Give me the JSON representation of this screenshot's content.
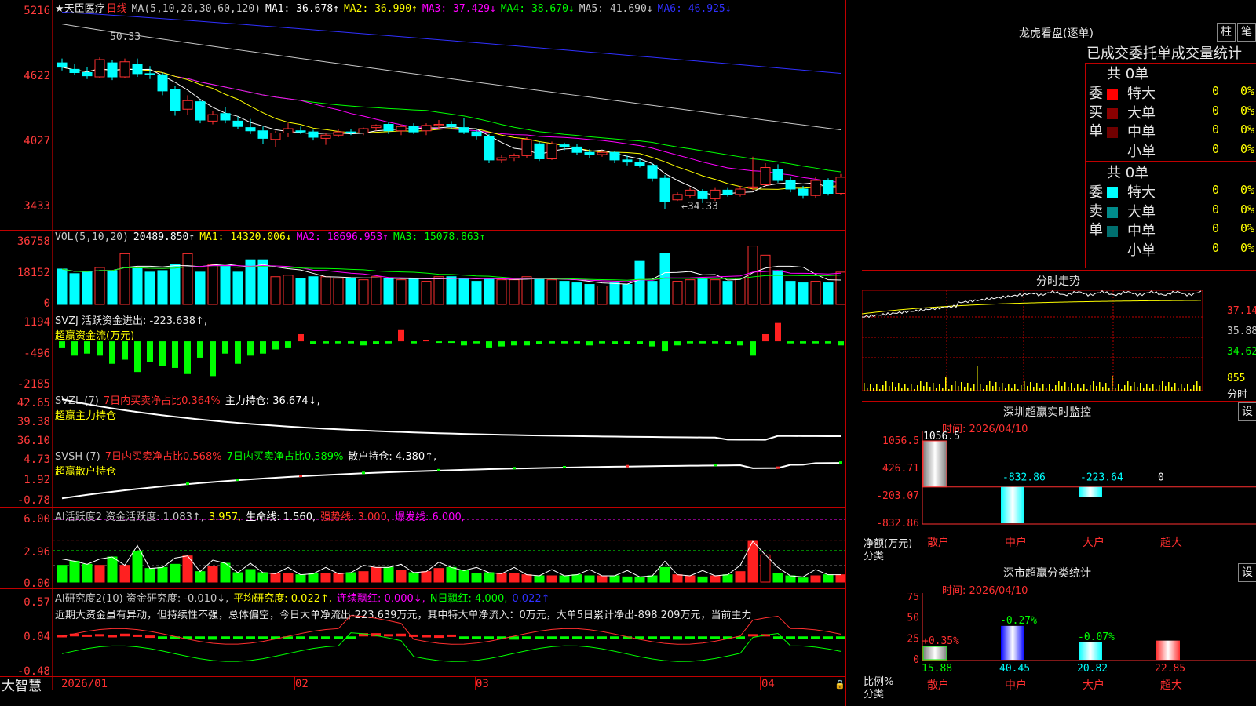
{
  "stock": {
    "name": "★天臣医疗",
    "period": "日线"
  },
  "main": {
    "price_axis": [
      "5216",
      "4622",
      "4027",
      "3433"
    ],
    "ma_title": "MA(5,10,20,30,60,120)",
    "ma": [
      {
        "label": "MA1: 36.678↑",
        "color": "#ffffff"
      },
      {
        "label": "MA2: 36.990↑",
        "color": "#ffff00"
      },
      {
        "label": "MA3: 37.429↓",
        "color": "#ff00ff"
      },
      {
        "label": "MA4: 38.670↓",
        "color": "#00ff00"
      },
      {
        "label": "MA5: 41.690↓",
        "color": "#c8c8c8"
      },
      {
        "label": "MA6: 46.925↓",
        "color": "#3030ff"
      }
    ],
    "high_label": "50.33",
    "low_label": "←34.33",
    "colors": {
      "up": "#ff3030",
      "down": "#00ffff",
      "ma1": "#ffffff",
      "ma2": "#ffff00",
      "ma3": "#ff00ff",
      "ma4": "#00ff00",
      "ma5": "#c8c8c8",
      "ma6": "#3030ff"
    }
  },
  "vol": {
    "axis": [
      "36758",
      "18152",
      "0"
    ],
    "title": "VOL(5,10,20)",
    "items": [
      {
        "label": "20489.850↑",
        "color": "#ffffff"
      },
      {
        "label": "MA1: 14320.006↓",
        "color": "#ffff00"
      },
      {
        "label": "MA2: 18696.953↑",
        "color": "#ff00ff"
      },
      {
        "label": "MA3: 15078.863↑",
        "color": "#00ff00"
      }
    ]
  },
  "svzj": {
    "axis": [
      "1194",
      "-496",
      "-2185"
    ],
    "title": "SVZJ  活跃资金进出: -223.638↑,",
    "subtitle": "超赢资金流(万元)"
  },
  "svzl": {
    "axis": [
      "42.65",
      "39.38",
      "36.10"
    ],
    "items": [
      {
        "label": "SVZL (7)",
        "color": "#c8c8c8"
      },
      {
        "label": "7日内买卖净占比0.364%",
        "color": "#ff3030"
      },
      {
        "label": "主力持仓: 36.674↓,",
        "color": "#ffffff"
      }
    ],
    "subtitle": "超赢主力持仓"
  },
  "svsh": {
    "axis": [
      "4.73",
      "1.92",
      "-0.78"
    ],
    "items": [
      {
        "label": "SVSH (7)",
        "color": "#c8c8c8"
      },
      {
        "label": "7日内买卖净占比0.568%",
        "color": "#ff3030"
      },
      {
        "label": "7日内买卖净占比0.389%",
        "color": "#00ff00"
      },
      {
        "label": "散户持仓: 4.380↑,",
        "color": "#ffffff"
      }
    ],
    "subtitle": "超赢散户持仓"
  },
  "ai_active": {
    "axis": [
      "6.00",
      "2.96",
      "0.00"
    ],
    "items": [
      {
        "label": "AI活跃度2 资金活跃度: 1.083↑,",
        "color": "#c8c8c8"
      },
      {
        "label": "3.957,",
        "color": "#ffff00"
      },
      {
        "label": "生命线: 1.560,",
        "color": "#ffffff"
      },
      {
        "label": "强势线: 3.000,",
        "color": "#ff3030"
      },
      {
        "label": "爆发线: 6.000,",
        "color": "#ff00ff"
      }
    ]
  },
  "ai_research": {
    "axis": [
      "0.57",
      "0.04",
      "-0.48"
    ],
    "items": [
      {
        "label": "AI研究度2(10) 资金研究度: -0.010↓,",
        "color": "#c8c8c8"
      },
      {
        "label": "平均研究度: 0.022↑,",
        "color": "#ffff00"
      },
      {
        "label": "连续飘红: 0.000↓,",
        "color": "#ff00ff"
      },
      {
        "label": "N日飘红: 4.000,",
        "color": "#00ff00"
      },
      {
        "label": "0.022↑",
        "color": "#3030ff"
      }
    ],
    "comment": "近期大资金虽有异动，但持续性不强，总体偏空，今日大单净流出-223.639万元，其中特大单净流入：0万元，大单5日累计净出-898.209万元，当前主力"
  },
  "date_axis": [
    "2026/01",
    "02",
    "03",
    "04"
  ],
  "brand": "大智慧",
  "right": {
    "lhb_title": "龙虎看盘(逐单)",
    "btn_zhu": "柱",
    "btn_bi": "笔",
    "tabs": [
      "已成交",
      "委托单",
      "成交量统计"
    ],
    "buy": {
      "side_label": "委买单",
      "total": "共 0单",
      "rows": [
        {
          "name": "特大",
          "color": "#ff0000",
          "value": "0",
          "pct": "0%"
        },
        {
          "name": "大单",
          "color": "#8b0000",
          "value": "0",
          "pct": "0%"
        },
        {
          "name": "中单",
          "color": "#700000",
          "value": "0",
          "pct": "0%"
        },
        {
          "name": "小单",
          "color": "#000000",
          "value": "0",
          "pct": "0%"
        }
      ]
    },
    "sell": {
      "side_label": "委卖单",
      "total": "共 0单",
      "rows": [
        {
          "name": "特大",
          "color": "#00ffff",
          "value": "0",
          "pct": "0%"
        },
        {
          "name": "大单",
          "color": "#008b8b",
          "value": "0",
          "pct": "0%"
        },
        {
          "name": "中单",
          "color": "#006f6f",
          "value": "0",
          "pct": "0%"
        },
        {
          "name": "小单",
          "color": "#000000",
          "value": "0",
          "pct": "0%"
        }
      ]
    },
    "intraday_title": "分时走势",
    "intraday_axis": [
      "37.14",
      "35.88",
      "34.62",
      "855"
    ],
    "intraday_label": "分时",
    "sz_monitor": {
      "title": "深圳超赢实时监控",
      "btn": "设",
      "time": "时间: 2026/04/10",
      "axis": [
        "1056.5",
        "426.71",
        "-203.07",
        "-832.86"
      ],
      "ylabel": "净额(万元)",
      "xlabel": "分类",
      "categories": [
        "散户",
        "中户",
        "大户",
        "超大"
      ],
      "values": [
        1056.5,
        -832.86,
        -223.64,
        0
      ],
      "value_labels": [
        "1056.5",
        "-832.86",
        "-223.64",
        "0"
      ]
    },
    "sz_class": {
      "title": "深市超赢分类统计",
      "btn": "设",
      "time": "时间: 2026/04/10",
      "axis": [
        "75",
        "50",
        "25",
        "0"
      ],
      "ylabel": "比例%",
      "xlabel": "分类",
      "categories": [
        "散户",
        "中户",
        "大户",
        "超大"
      ],
      "values": [
        15.88,
        40.45,
        20.82,
        22.85
      ],
      "value_labels": [
        "15.88",
        "40.45",
        "20.82",
        "22.85"
      ],
      "change_labels": [
        "+0.35%",
        "-0.27%",
        "-0.07%",
        ""
      ]
    }
  },
  "chart_data": [
    {
      "type": "candlestick",
      "title": "★天臣医疗 日线",
      "ylim": [
        33.0,
        53.0
      ],
      "bars": [
        [
          47.9,
          48.3,
          47.2,
          47.5
        ],
        [
          47.3,
          47.8,
          46.8,
          47.0
        ],
        [
          47.0,
          47.5,
          46.4,
          46.7
        ],
        [
          46.6,
          48.4,
          46.5,
          48.2
        ],
        [
          47.9,
          48.2,
          46.3,
          46.6
        ],
        [
          46.6,
          48.3,
          46.5,
          48.0
        ],
        [
          47.8,
          48.3,
          46.6,
          46.9
        ],
        [
          46.9,
          47.6,
          46.4,
          46.8
        ],
        [
          46.8,
          47.0,
          44.9,
          45.3
        ],
        [
          45.4,
          45.8,
          43.0,
          43.5
        ],
        [
          43.6,
          44.9,
          43.1,
          44.4
        ],
        [
          44.3,
          44.5,
          42.3,
          42.6
        ],
        [
          42.5,
          43.4,
          42.2,
          43.1
        ],
        [
          43.2,
          43.8,
          42.3,
          42.6
        ],
        [
          42.5,
          42.9,
          41.8,
          42.0
        ],
        [
          41.9,
          42.7,
          41.3,
          41.6
        ],
        [
          41.6,
          42.0,
          40.4,
          40.9
        ],
        [
          40.8,
          41.6,
          40.1,
          41.4
        ],
        [
          41.4,
          42.3,
          41.0,
          41.8
        ],
        [
          41.6,
          42.0,
          41.3,
          41.5
        ],
        [
          41.5,
          41.7,
          40.7,
          41.0
        ],
        [
          40.9,
          41.4,
          40.3,
          41.2
        ],
        [
          41.2,
          41.8,
          41.0,
          41.5
        ],
        [
          41.5,
          41.8,
          41.2,
          41.4
        ],
        [
          41.4,
          41.9,
          41.2,
          41.8
        ],
        [
          41.9,
          42.2,
          41.6,
          42.1
        ],
        [
          42.2,
          42.4,
          41.3,
          41.6
        ],
        [
          41.6,
          42.2,
          41.2,
          42.0
        ],
        [
          42.0,
          42.3,
          41.3,
          41.5
        ],
        [
          41.6,
          42.3,
          41.2,
          42.1
        ],
        [
          42.1,
          42.6,
          41.8,
          42.2
        ],
        [
          42.2,
          42.5,
          41.8,
          42.0
        ],
        [
          41.9,
          42.8,
          41.3,
          41.5
        ],
        [
          41.5,
          41.8,
          40.8,
          41.1
        ],
        [
          41.1,
          41.3,
          38.6,
          38.9
        ],
        [
          38.9,
          39.4,
          38.6,
          39.1
        ],
        [
          39.1,
          39.5,
          38.8,
          39.3
        ],
        [
          39.3,
          41.0,
          39.1,
          40.8
        ],
        [
          40.4,
          40.6,
          38.8,
          39.0
        ],
        [
          39.0,
          40.6,
          38.9,
          40.4
        ],
        [
          40.3,
          40.5,
          39.8,
          40.1
        ],
        [
          40.1,
          40.4,
          39.4,
          39.6
        ],
        [
          39.6,
          39.9,
          39.1,
          39.4
        ],
        [
          39.4,
          39.8,
          39.2,
          39.6
        ],
        [
          39.6,
          39.7,
          38.6,
          38.9
        ],
        [
          38.9,
          39.3,
          38.4,
          38.7
        ],
        [
          38.7,
          39.0,
          38.2,
          38.4
        ],
        [
          38.4,
          38.6,
          36.9,
          37.2
        ],
        [
          37.2,
          37.5,
          34.33,
          35.0
        ],
        [
          35.2,
          35.9,
          35.1,
          35.7
        ],
        [
          35.6,
          36.3,
          35.4,
          36.1
        ],
        [
          36.0,
          36.2,
          34.9,
          35.3
        ],
        [
          35.3,
          36.3,
          35.1,
          36.1
        ],
        [
          36.1,
          36.3,
          35.5,
          35.7
        ],
        [
          35.7,
          36.5,
          35.5,
          36.2
        ],
        [
          36.3,
          39.2,
          36.1,
          36.4
        ],
        [
          36.6,
          38.6,
          36.4,
          38.2
        ],
        [
          38.0,
          38.5,
          36.8,
          37.0
        ],
        [
          37.0,
          37.3,
          35.9,
          36.2
        ],
        [
          36.2,
          36.5,
          35.3,
          35.6
        ],
        [
          35.6,
          37.3,
          35.4,
          37.0
        ],
        [
          37.0,
          37.2,
          35.6,
          35.8
        ],
        [
          35.8,
          37.6,
          35.7,
          37.3
        ]
      ],
      "annotations": [
        "50.33",
        "←34.33"
      ]
    }
  ]
}
